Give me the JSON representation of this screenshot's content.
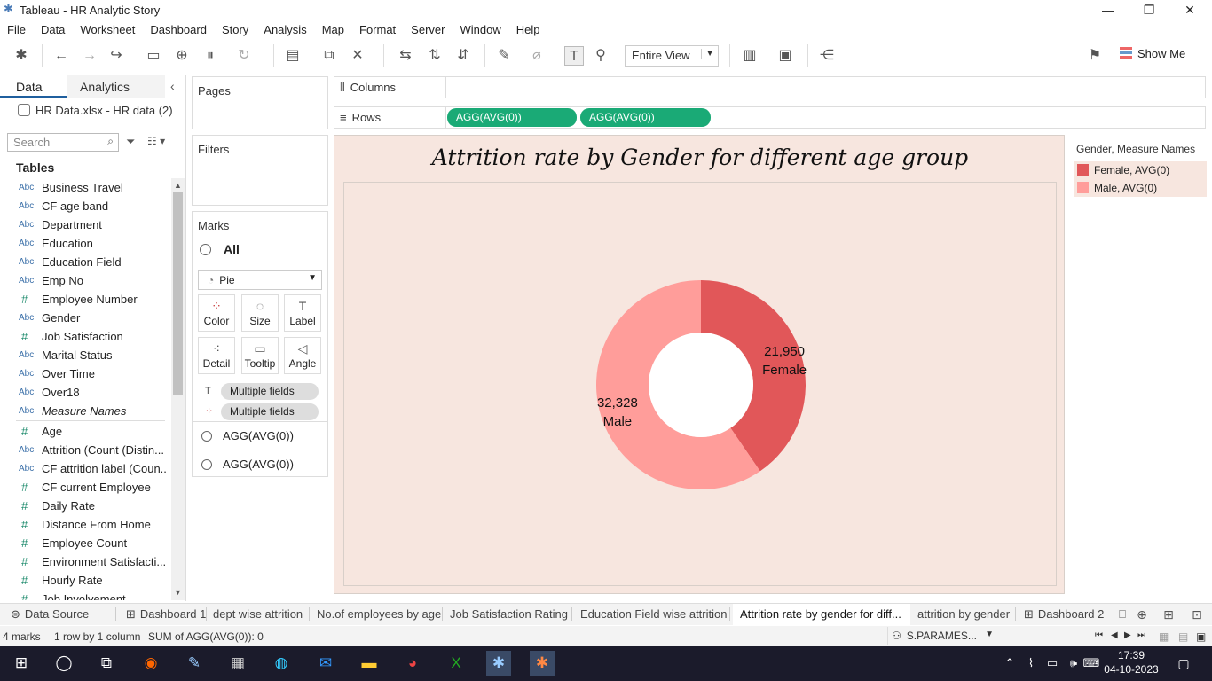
{
  "window": {
    "title": "Tableau - HR Analytic Story"
  },
  "menu": [
    "File",
    "Data",
    "Worksheet",
    "Dashboard",
    "Story",
    "Analysis",
    "Map",
    "Format",
    "Server",
    "Window",
    "Help"
  ],
  "toolbar": {
    "view_mode": "Entire View",
    "show_me": "Show Me"
  },
  "data_pane": {
    "tabs": [
      "Data",
      "Analytics"
    ],
    "datasource": "HR Data.xlsx - HR data (2)",
    "search_placeholder": "Search",
    "tables_heading": "Tables",
    "fields": [
      {
        "type": "Abc",
        "name": "Business Travel"
      },
      {
        "type": "Abc",
        "name": "CF age band"
      },
      {
        "type": "Abc",
        "name": "Department"
      },
      {
        "type": "Abc",
        "name": "Education"
      },
      {
        "type": "Abc",
        "name": "Education Field"
      },
      {
        "type": "Abc",
        "name": "Emp No"
      },
      {
        "type": "#",
        "name": "Employee Number"
      },
      {
        "type": "Abc",
        "name": "Gender"
      },
      {
        "type": "#",
        "name": "Job Satisfaction"
      },
      {
        "type": "Abc",
        "name": "Marital Status"
      },
      {
        "type": "Abc",
        "name": "Over Time"
      },
      {
        "type": "Abc",
        "name": "Over18"
      },
      {
        "type": "Abc",
        "name": "Measure Names",
        "italic": true
      },
      {
        "type": "#",
        "name": "Age"
      },
      {
        "type": "Abc",
        "name": "Attrition (Count (Distin..."
      },
      {
        "type": "Abc",
        "name": "CF attrition label (Coun..."
      },
      {
        "type": "#",
        "name": "CF current Employee"
      },
      {
        "type": "#",
        "name": "Daily Rate"
      },
      {
        "type": "#",
        "name": "Distance From Home"
      },
      {
        "type": "#",
        "name": "Employee Count"
      },
      {
        "type": "#",
        "name": "Environment Satisfacti..."
      },
      {
        "type": "#",
        "name": "Hourly Rate"
      },
      {
        "type": "#",
        "name": "Job Involvement"
      }
    ]
  },
  "shelves": {
    "pages": "Pages",
    "filters": "Filters",
    "marks": "Marks",
    "marks_all": "All",
    "mark_type": "Pie",
    "mark_buttons": [
      "Color",
      "Size",
      "Label",
      "Detail",
      "Tooltip",
      "Angle"
    ],
    "mark_pills": [
      "Multiple fields",
      "Multiple fields"
    ],
    "agg_rows": [
      "AGG(AVG(0))",
      "AGG(AVG(0))"
    ],
    "columns_label": "Columns",
    "rows_label": "Rows",
    "row_pills": [
      "AGG(AVG(0))",
      "AGG(AVG(0))"
    ]
  },
  "chart_data": {
    "type": "pie",
    "donut": true,
    "title": "Attrition rate by Gender for different age group",
    "slices": [
      {
        "label": "Female",
        "value": 21950,
        "display": "21,950",
        "color": "#e15759"
      },
      {
        "label": "Male",
        "value": 32328,
        "display": "32,328",
        "color": "#ff9d9a"
      }
    ],
    "background": "#f7e6df"
  },
  "legend": {
    "title": "Gender, Measure Names",
    "items": [
      {
        "label": "Female, AVG(0)",
        "color": "#e15759"
      },
      {
        "label": "Male, AVG(0)",
        "color": "#ff9d9a"
      }
    ]
  },
  "sheet_tabs": [
    "Data Source",
    "Dashboard 1",
    "dept wise attrition",
    "No.of employees by age",
    "Job Satisfaction Rating",
    "Education Field wise attrition",
    "Attrition rate by gender for diff...",
    "attrition by gender",
    "Dashboard 2"
  ],
  "status": {
    "marks": "4 marks",
    "rows_cols": "1 row by 1 column",
    "sum": "SUM of AGG(AVG(0)): 0",
    "user": "S.PARAMES..."
  },
  "clock": {
    "time": "17:39",
    "date": "04-10-2023"
  }
}
